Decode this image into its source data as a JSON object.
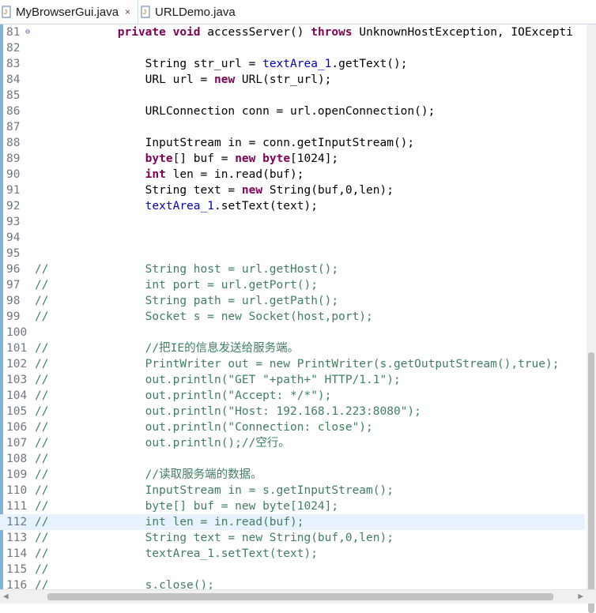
{
  "tabs": [
    {
      "label": "MyBrowserGui.java",
      "close_glyph": "×",
      "active": true
    },
    {
      "label": "URLDemo.java",
      "active": false
    }
  ],
  "editor": {
    "current_line": "112",
    "lines": [
      {
        "n": "81",
        "fold": "⊖",
        "parts": [
          [
            "pln",
            "            "
          ],
          [
            "kw",
            "private void"
          ],
          [
            "pln",
            " accessServer() "
          ],
          [
            "kw",
            "throws"
          ],
          [
            "pln",
            " UnknownHostException, IOExcepti"
          ]
        ]
      },
      {
        "n": "82",
        "parts": []
      },
      {
        "n": "83",
        "parts": [
          [
            "pln",
            "                String str_url = "
          ],
          [
            "fld",
            "textArea_1"
          ],
          [
            "pln",
            ".getText();"
          ]
        ]
      },
      {
        "n": "84",
        "parts": [
          [
            "pln",
            "                URL url = "
          ],
          [
            "kw",
            "new"
          ],
          [
            "pln",
            " URL(str_url);"
          ]
        ]
      },
      {
        "n": "85",
        "parts": []
      },
      {
        "n": "86",
        "parts": [
          [
            "pln",
            "                URLConnection conn = url.openConnection();"
          ]
        ]
      },
      {
        "n": "87",
        "parts": []
      },
      {
        "n": "88",
        "parts": [
          [
            "pln",
            "                InputStream in = conn.getInputStream();"
          ]
        ]
      },
      {
        "n": "89",
        "parts": [
          [
            "kw",
            "                byte"
          ],
          [
            "pln",
            "[] buf = "
          ],
          [
            "kw",
            "new"
          ],
          [
            "pln",
            " "
          ],
          [
            "kw",
            "byte"
          ],
          [
            "pln",
            "[1024];"
          ]
        ]
      },
      {
        "n": "90",
        "parts": [
          [
            "kw",
            "                int"
          ],
          [
            "pln",
            " len = in.read(buf);"
          ]
        ]
      },
      {
        "n": "91",
        "parts": [
          [
            "pln",
            "                String text = "
          ],
          [
            "kw",
            "new"
          ],
          [
            "pln",
            " String(buf,0,len);"
          ]
        ]
      },
      {
        "n": "92",
        "parts": [
          [
            "fld",
            "                textArea_1"
          ],
          [
            "pln",
            ".setText(text);"
          ]
        ]
      },
      {
        "n": "93",
        "parts": []
      },
      {
        "n": "94",
        "parts": []
      },
      {
        "n": "95",
        "parts": []
      },
      {
        "n": "96",
        "parts": [
          [
            "cmt",
            "//              String host = url.getHost();"
          ]
        ]
      },
      {
        "n": "97",
        "parts": [
          [
            "cmt",
            "//              int port = url.getPort();"
          ]
        ]
      },
      {
        "n": "98",
        "parts": [
          [
            "cmt",
            "//              String path = url.getPath();"
          ]
        ]
      },
      {
        "n": "99",
        "parts": [
          [
            "cmt",
            "//              Socket s = new Socket(host,port);"
          ]
        ]
      },
      {
        "n": "100",
        "parts": []
      },
      {
        "n": "101",
        "parts": [
          [
            "cmt",
            "//              //把IE的信息发送给服务端。"
          ]
        ]
      },
      {
        "n": "102",
        "parts": [
          [
            "cmt",
            "//              PrintWriter out = new PrintWriter(s.getOutputStream(),true);"
          ]
        ]
      },
      {
        "n": "103",
        "parts": [
          [
            "cmt",
            "//              out.println(\"GET \"+path+\" HTTP/1.1\");"
          ]
        ]
      },
      {
        "n": "104",
        "parts": [
          [
            "cmt",
            "//              out.println(\"Accept: */*\");"
          ]
        ]
      },
      {
        "n": "105",
        "parts": [
          [
            "cmt",
            "//              out.println(\"Host: 192.168.1.223:8080\");"
          ]
        ]
      },
      {
        "n": "106",
        "parts": [
          [
            "cmt",
            "//              out.println(\"Connection: close\");"
          ]
        ]
      },
      {
        "n": "107",
        "parts": [
          [
            "cmt",
            "//              out.println();//空行。"
          ]
        ]
      },
      {
        "n": "108",
        "parts": [
          [
            "cmt",
            "//"
          ]
        ]
      },
      {
        "n": "109",
        "parts": [
          [
            "cmt",
            "//              //读取服务端的数据。"
          ]
        ]
      },
      {
        "n": "110",
        "parts": [
          [
            "cmt",
            "//              InputStream in = s.getInputStream();"
          ]
        ]
      },
      {
        "n": "111",
        "parts": [
          [
            "cmt",
            "//              byte[] buf = new byte[1024];"
          ]
        ]
      },
      {
        "n": "112",
        "parts": [
          [
            "cmt",
            "//              int len = in.read(buf);"
          ]
        ]
      },
      {
        "n": "113",
        "parts": [
          [
            "cmt",
            "//              String text = new String(buf,0,len);"
          ]
        ]
      },
      {
        "n": "114",
        "parts": [
          [
            "cmt",
            "//              textArea_1.setText(text);"
          ]
        ]
      },
      {
        "n": "115",
        "parts": [
          [
            "cmt",
            "//"
          ]
        ]
      },
      {
        "n": "116",
        "parts": [
          [
            "cmt",
            "//              s.close();"
          ]
        ]
      }
    ]
  },
  "scrollbars": {
    "left_arrow": "◀",
    "right_arrow": "▶"
  },
  "colors": {
    "keyword": "#7f0055",
    "field": "#0000c0",
    "comment": "#3f7f5f",
    "current_line": "#e8f2fe"
  }
}
